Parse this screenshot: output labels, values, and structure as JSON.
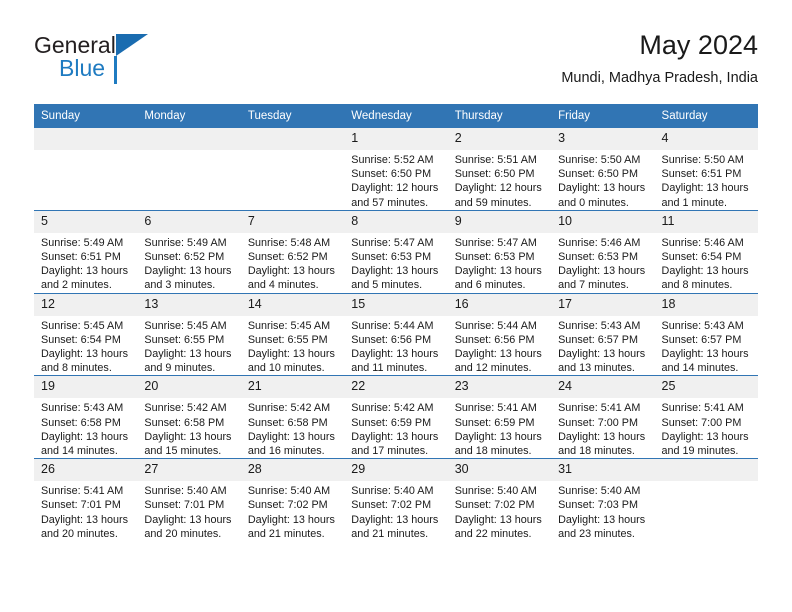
{
  "logo": {
    "primary": "General",
    "secondary": "Blue",
    "triangle_color": "#1a6cb0",
    "secondary_color": "#1f7bc1"
  },
  "header": {
    "title": "May 2024",
    "subtitle": "Mundi, Madhya Pradesh, India"
  },
  "calendar": {
    "header_color": "#3175b4",
    "daynum_bg": "#f0f0f0",
    "weekday_headers": [
      "Sunday",
      "Monday",
      "Tuesday",
      "Wednesday",
      "Thursday",
      "Friday",
      "Saturday"
    ],
    "labels": {
      "sunrise": "Sunrise:",
      "sunset": "Sunset:",
      "daylight": "Daylight:"
    },
    "weeks": [
      [
        {
          "day": "",
          "empty": true
        },
        {
          "day": "",
          "empty": true
        },
        {
          "day": "",
          "empty": true
        },
        {
          "day": "1",
          "sunrise": "Sunrise: 5:52 AM",
          "sunset": "Sunset: 6:50 PM",
          "daylight_1": "Daylight: 12 hours",
          "daylight_2": "and 57 minutes."
        },
        {
          "day": "2",
          "sunrise": "Sunrise: 5:51 AM",
          "sunset": "Sunset: 6:50 PM",
          "daylight_1": "Daylight: 12 hours",
          "daylight_2": "and 59 minutes."
        },
        {
          "day": "3",
          "sunrise": "Sunrise: 5:50 AM",
          "sunset": "Sunset: 6:50 PM",
          "daylight_1": "Daylight: 13 hours",
          "daylight_2": "and 0 minutes."
        },
        {
          "day": "4",
          "sunrise": "Sunrise: 5:50 AM",
          "sunset": "Sunset: 6:51 PM",
          "daylight_1": "Daylight: 13 hours",
          "daylight_2": "and 1 minute."
        }
      ],
      [
        {
          "day": "5",
          "sunrise": "Sunrise: 5:49 AM",
          "sunset": "Sunset: 6:51 PM",
          "daylight_1": "Daylight: 13 hours",
          "daylight_2": "and 2 minutes."
        },
        {
          "day": "6",
          "sunrise": "Sunrise: 5:49 AM",
          "sunset": "Sunset: 6:52 PM",
          "daylight_1": "Daylight: 13 hours",
          "daylight_2": "and 3 minutes."
        },
        {
          "day": "7",
          "sunrise": "Sunrise: 5:48 AM",
          "sunset": "Sunset: 6:52 PM",
          "daylight_1": "Daylight: 13 hours",
          "daylight_2": "and 4 minutes."
        },
        {
          "day": "8",
          "sunrise": "Sunrise: 5:47 AM",
          "sunset": "Sunset: 6:53 PM",
          "daylight_1": "Daylight: 13 hours",
          "daylight_2": "and 5 minutes."
        },
        {
          "day": "9",
          "sunrise": "Sunrise: 5:47 AM",
          "sunset": "Sunset: 6:53 PM",
          "daylight_1": "Daylight: 13 hours",
          "daylight_2": "and 6 minutes."
        },
        {
          "day": "10",
          "sunrise": "Sunrise: 5:46 AM",
          "sunset": "Sunset: 6:53 PM",
          "daylight_1": "Daylight: 13 hours",
          "daylight_2": "and 7 minutes."
        },
        {
          "day": "11",
          "sunrise": "Sunrise: 5:46 AM",
          "sunset": "Sunset: 6:54 PM",
          "daylight_1": "Daylight: 13 hours",
          "daylight_2": "and 8 minutes."
        }
      ],
      [
        {
          "day": "12",
          "sunrise": "Sunrise: 5:45 AM",
          "sunset": "Sunset: 6:54 PM",
          "daylight_1": "Daylight: 13 hours",
          "daylight_2": "and 8 minutes."
        },
        {
          "day": "13",
          "sunrise": "Sunrise: 5:45 AM",
          "sunset": "Sunset: 6:55 PM",
          "daylight_1": "Daylight: 13 hours",
          "daylight_2": "and 9 minutes."
        },
        {
          "day": "14",
          "sunrise": "Sunrise: 5:45 AM",
          "sunset": "Sunset: 6:55 PM",
          "daylight_1": "Daylight: 13 hours",
          "daylight_2": "and 10 minutes."
        },
        {
          "day": "15",
          "sunrise": "Sunrise: 5:44 AM",
          "sunset": "Sunset: 6:56 PM",
          "daylight_1": "Daylight: 13 hours",
          "daylight_2": "and 11 minutes."
        },
        {
          "day": "16",
          "sunrise": "Sunrise: 5:44 AM",
          "sunset": "Sunset: 6:56 PM",
          "daylight_1": "Daylight: 13 hours",
          "daylight_2": "and 12 minutes."
        },
        {
          "day": "17",
          "sunrise": "Sunrise: 5:43 AM",
          "sunset": "Sunset: 6:57 PM",
          "daylight_1": "Daylight: 13 hours",
          "daylight_2": "and 13 minutes."
        },
        {
          "day": "18",
          "sunrise": "Sunrise: 5:43 AM",
          "sunset": "Sunset: 6:57 PM",
          "daylight_1": "Daylight: 13 hours",
          "daylight_2": "and 14 minutes."
        }
      ],
      [
        {
          "day": "19",
          "sunrise": "Sunrise: 5:43 AM",
          "sunset": "Sunset: 6:58 PM",
          "daylight_1": "Daylight: 13 hours",
          "daylight_2": "and 14 minutes."
        },
        {
          "day": "20",
          "sunrise": "Sunrise: 5:42 AM",
          "sunset": "Sunset: 6:58 PM",
          "daylight_1": "Daylight: 13 hours",
          "daylight_2": "and 15 minutes."
        },
        {
          "day": "21",
          "sunrise": "Sunrise: 5:42 AM",
          "sunset": "Sunset: 6:58 PM",
          "daylight_1": "Daylight: 13 hours",
          "daylight_2": "and 16 minutes."
        },
        {
          "day": "22",
          "sunrise": "Sunrise: 5:42 AM",
          "sunset": "Sunset: 6:59 PM",
          "daylight_1": "Daylight: 13 hours",
          "daylight_2": "and 17 minutes."
        },
        {
          "day": "23",
          "sunrise": "Sunrise: 5:41 AM",
          "sunset": "Sunset: 6:59 PM",
          "daylight_1": "Daylight: 13 hours",
          "daylight_2": "and 18 minutes."
        },
        {
          "day": "24",
          "sunrise": "Sunrise: 5:41 AM",
          "sunset": "Sunset: 7:00 PM",
          "daylight_1": "Daylight: 13 hours",
          "daylight_2": "and 18 minutes."
        },
        {
          "day": "25",
          "sunrise": "Sunrise: 5:41 AM",
          "sunset": "Sunset: 7:00 PM",
          "daylight_1": "Daylight: 13 hours",
          "daylight_2": "and 19 minutes."
        }
      ],
      [
        {
          "day": "26",
          "sunrise": "Sunrise: 5:41 AM",
          "sunset": "Sunset: 7:01 PM",
          "daylight_1": "Daylight: 13 hours",
          "daylight_2": "and 20 minutes."
        },
        {
          "day": "27",
          "sunrise": "Sunrise: 5:40 AM",
          "sunset": "Sunset: 7:01 PM",
          "daylight_1": "Daylight: 13 hours",
          "daylight_2": "and 20 minutes."
        },
        {
          "day": "28",
          "sunrise": "Sunrise: 5:40 AM",
          "sunset": "Sunset: 7:02 PM",
          "daylight_1": "Daylight: 13 hours",
          "daylight_2": "and 21 minutes."
        },
        {
          "day": "29",
          "sunrise": "Sunrise: 5:40 AM",
          "sunset": "Sunset: 7:02 PM",
          "daylight_1": "Daylight: 13 hours",
          "daylight_2": "and 21 minutes."
        },
        {
          "day": "30",
          "sunrise": "Sunrise: 5:40 AM",
          "sunset": "Sunset: 7:02 PM",
          "daylight_1": "Daylight: 13 hours",
          "daylight_2": "and 22 minutes."
        },
        {
          "day": "31",
          "sunrise": "Sunrise: 5:40 AM",
          "sunset": "Sunset: 7:03 PM",
          "daylight_1": "Daylight: 13 hours",
          "daylight_2": "and 23 minutes."
        },
        {
          "day": "",
          "empty": true
        }
      ]
    ]
  }
}
